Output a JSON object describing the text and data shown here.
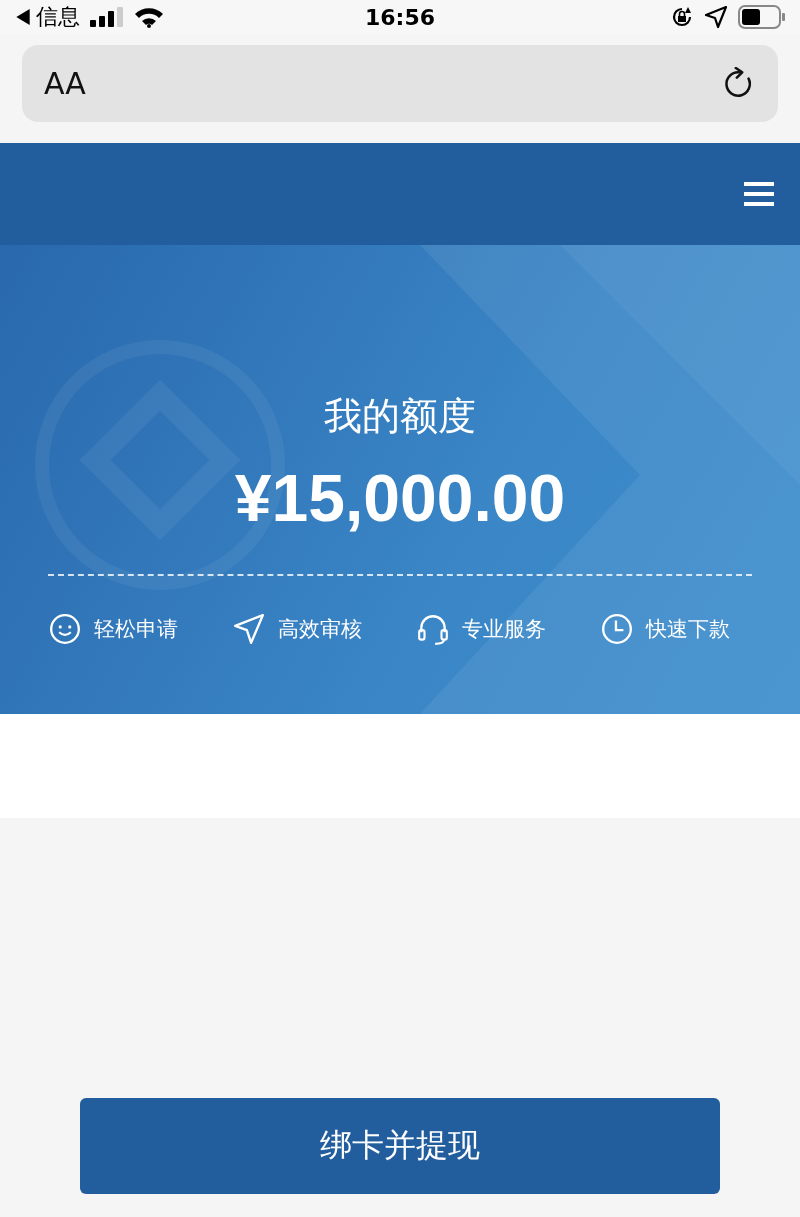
{
  "status_bar": {
    "back_label": "信息",
    "time": "16:56"
  },
  "address_bar": {
    "text_size_label": "AA"
  },
  "hero": {
    "title": "我的额度",
    "amount": "¥15,000.00"
  },
  "features": [
    {
      "kind": "smile",
      "label": "轻松申请"
    },
    {
      "kind": "send",
      "label": "高效审核"
    },
    {
      "kind": "headset",
      "label": "专业服务"
    },
    {
      "kind": "clock",
      "label": "快速下款"
    }
  ],
  "action_button": {
    "label": "绑卡并提现"
  }
}
